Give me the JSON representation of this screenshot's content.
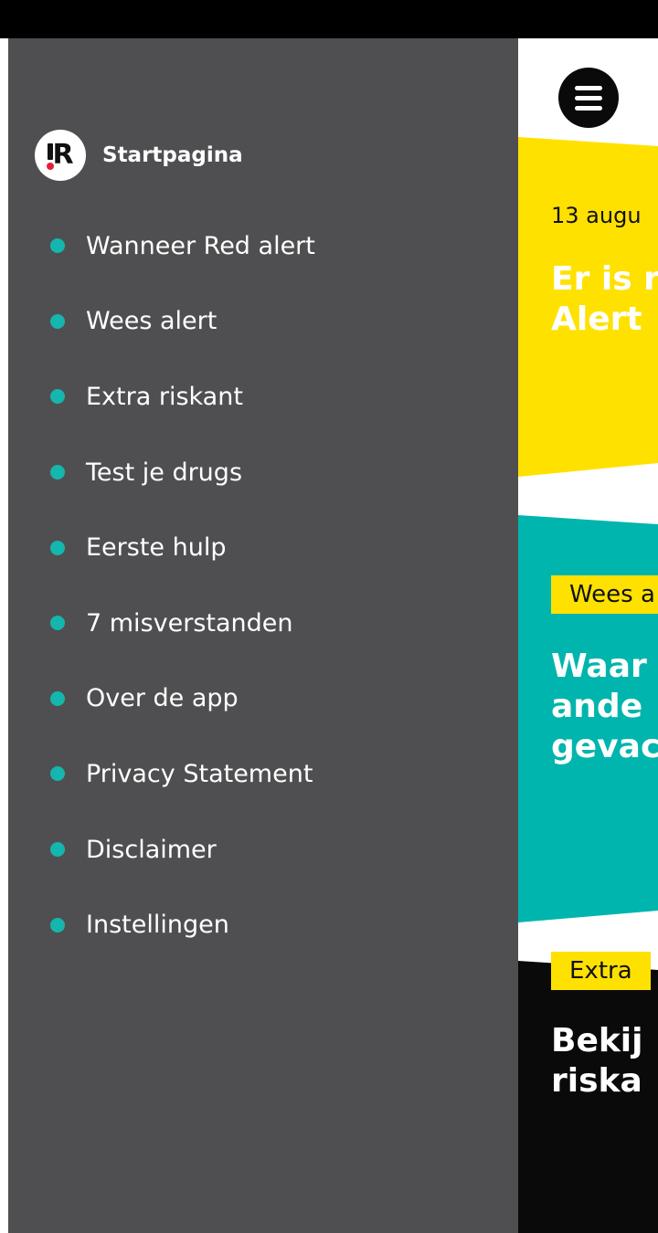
{
  "drawer": {
    "home_label": "Startpagina",
    "logo_letter": "R",
    "items": [
      {
        "label": "Wanneer Red alert"
      },
      {
        "label": "Wees alert"
      },
      {
        "label": "Extra riskant"
      },
      {
        "label": "Test je drugs"
      },
      {
        "label": "Eerste hulp"
      },
      {
        "label": "7 misverstanden"
      },
      {
        "label": "Over de app"
      },
      {
        "label": "Privacy Statement"
      },
      {
        "label": "Disclaimer"
      },
      {
        "label": "Instellingen"
      }
    ]
  },
  "content": {
    "alert_card": {
      "date": "13 augu",
      "title_line1": "Er is r",
      "title_line2": "Alert"
    },
    "wees_card": {
      "tag": "Wees a",
      "title_line1": "Waar",
      "title_line2": "ande",
      "title_line3": "gevac"
    },
    "extra_card": {
      "tag": "Extra",
      "title_line1": "Bekij",
      "title_line2": "riska"
    }
  },
  "colors": {
    "drawer_bg": "#4f4f51",
    "bullet": "#14b6ae",
    "yellow": "#ffe100",
    "teal": "#00b5ad",
    "black": "#0a0a0a",
    "logo_dot": "#e3203a"
  },
  "icons": {
    "menu": "hamburger-menu-icon",
    "logo": "red-alert-logo"
  }
}
